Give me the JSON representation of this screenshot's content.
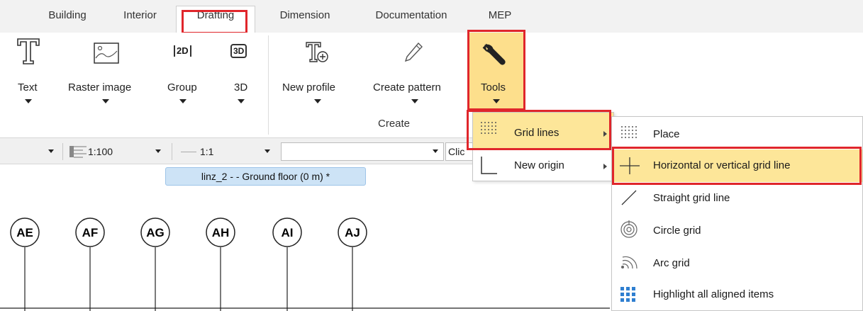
{
  "tabs": [
    {
      "label": "Building"
    },
    {
      "label": "Interior"
    },
    {
      "label": "Drafting"
    },
    {
      "label": "Dimension"
    },
    {
      "label": "Documentation"
    },
    {
      "label": "MEP"
    }
  ],
  "ribbon": {
    "text_label": "Text",
    "raster_label": "Raster image",
    "group_label": "Group",
    "three_d_label": "3D",
    "group_2d_badge": "2D",
    "group_3d_badge": "3D",
    "new_profile_label": "New profile",
    "create_pattern_label": "Create pattern",
    "tools_label": "Tools",
    "create_group_label": "Create"
  },
  "toolbar": {
    "scale_value": "1:100",
    "ratio_value": "1:1",
    "input_value": "",
    "truncated_text": "Clic"
  },
  "document_tab": {
    "title": "linz_2 -  - Ground floor (0 m) *"
  },
  "grid_markers": [
    "AE",
    "AF",
    "AG",
    "AH",
    "AI",
    "AJ"
  ],
  "tools_menu": {
    "items": [
      {
        "label": "Grid lines",
        "icon": "grid-dots-icon"
      },
      {
        "label": "New origin",
        "icon": "origin-axis-icon"
      }
    ]
  },
  "grid_submenu": {
    "items": [
      {
        "label": "Place",
        "icon": "grid-dots-icon"
      },
      {
        "label": "Horizontal or vertical grid line",
        "icon": "crosshair-icon"
      },
      {
        "label": "Straight grid line",
        "icon": "diagonal-line-icon"
      },
      {
        "label": "Circle grid",
        "icon": "concentric-circles-icon"
      },
      {
        "label": "Arc grid",
        "icon": "arc-grid-icon"
      },
      {
        "label": "Highlight all aligned items",
        "icon": "blue-grid-icon"
      }
    ]
  },
  "colors": {
    "highlight": "#fde699",
    "annotation_red": "#e0262b",
    "doc_tab_bg": "#cde3f6",
    "tools_bg": "#fddf8c"
  }
}
